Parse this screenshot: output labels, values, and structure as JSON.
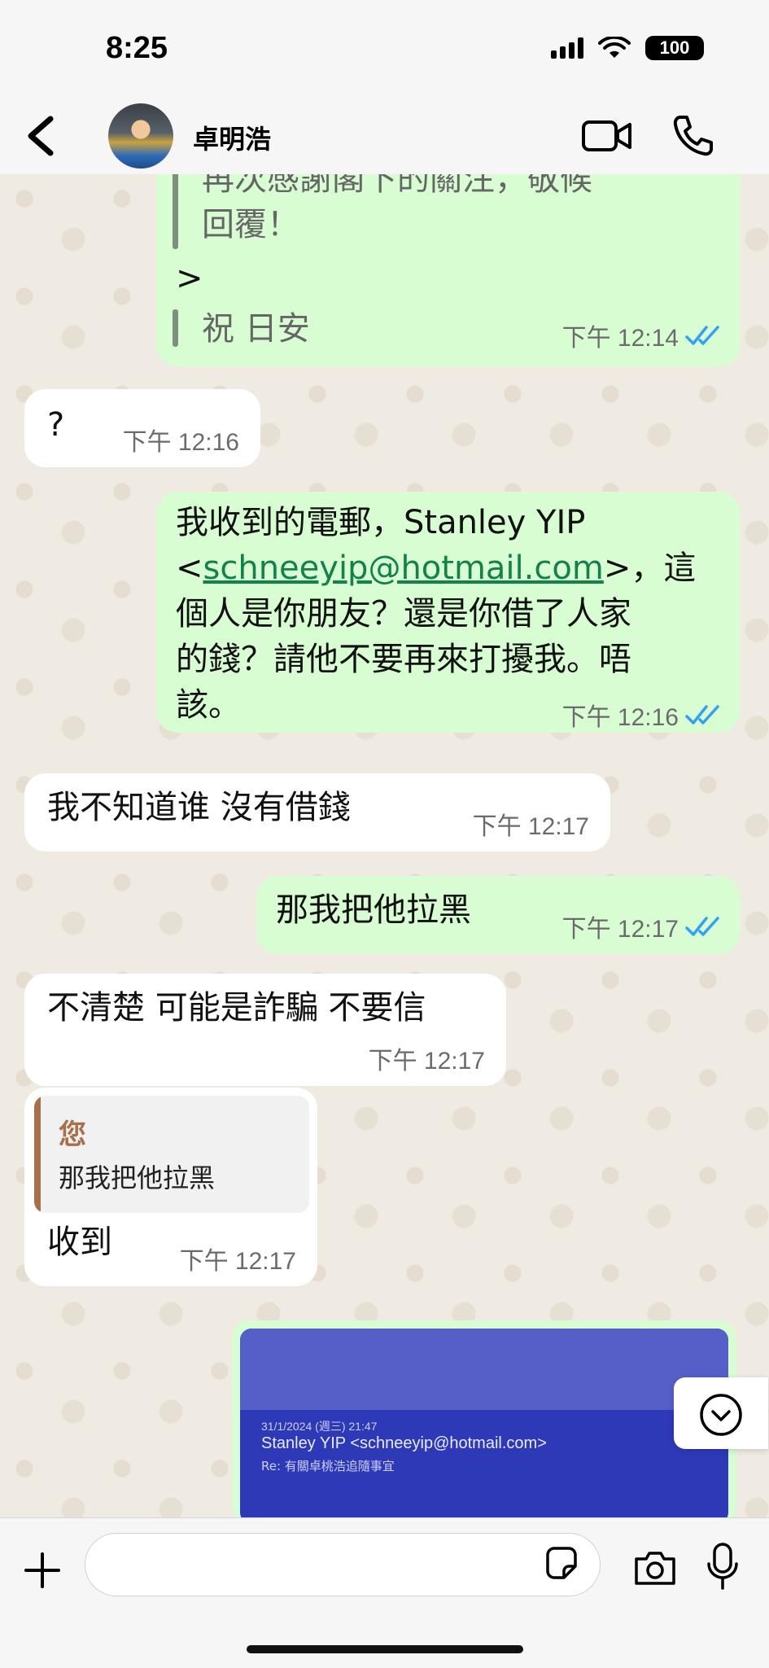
{
  "status_bar": {
    "time": "8:25",
    "battery": "100"
  },
  "header": {
    "contact_name": "卓明浩"
  },
  "messages": [
    {
      "id": "m1",
      "direction": "out",
      "line1": "再次感謝閣下的關注，敬候",
      "line2": "回覆！",
      "line3": ">",
      "line4": "祝 日安",
      "time": "下午 12:14"
    },
    {
      "id": "m2",
      "direction": "in",
      "text": "?",
      "time": "下午 12:16"
    },
    {
      "id": "m3",
      "direction": "out",
      "line1": "我收到的電郵，Stanley YIP",
      "line2_pre": "<",
      "line2_link": "schneeyip@hotmail.com",
      "line2_post": ">，這",
      "line3": "個人是你朋友？還是你借了人家",
      "line4": "的錢？請他不要再來打擾我。唔",
      "line5": "該。",
      "time": "下午 12:16"
    },
    {
      "id": "m4",
      "direction": "in",
      "text": "我不知道谁 沒有借錢",
      "time": "下午 12:17"
    },
    {
      "id": "m5",
      "direction": "out",
      "text": "那我把他拉黑",
      "time": "下午 12:17"
    },
    {
      "id": "m6",
      "direction": "in",
      "text": "不清楚 可能是詐騙 不要信",
      "time": "下午 12:17"
    },
    {
      "id": "m7",
      "direction": "in",
      "reply_name": "您",
      "reply_text": "那我把他拉黑",
      "text": "收到",
      "time": "下午 12:17"
    }
  ],
  "image_message": {
    "sender": "Stanley YIP <schneeyip@hotmail.com>",
    "date": "31/1/2024 (週三) 21:47",
    "subject": "Re: 有關卓桃浩追隨事宜"
  },
  "colors": {
    "outgoing": "#d9fdd3",
    "incoming": "#ffffff",
    "read_tick": "#34a0f0",
    "link": "#12814a"
  },
  "icons": [
    "back-arrow-icon",
    "video-call-icon",
    "phone-icon",
    "double-check-icon",
    "chevron-down-icon",
    "plus-icon",
    "sticker-icon",
    "camera-icon",
    "mic-icon"
  ]
}
